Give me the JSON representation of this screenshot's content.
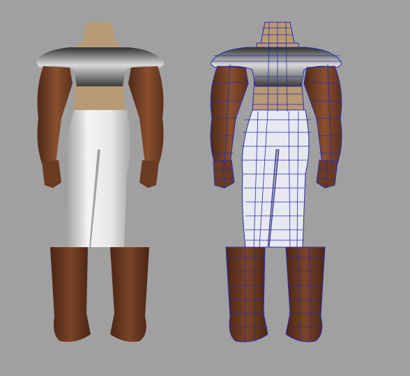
{
  "viewport": {
    "background": "#a0a0a0"
  },
  "models": [
    {
      "view": "smooth-shaded"
    },
    {
      "view": "wireframe-on-shaded",
      "wire_color": "#2a2ab0"
    }
  ],
  "colors": {
    "skin": "#6b3a22",
    "skin_highlight": "#8a4f2e",
    "armor": "#4a4a4a",
    "armor_highlight": "#d8d8d8",
    "torso": "#b89a74",
    "pants": "#e6e6e6",
    "boots": "#6e3c22"
  }
}
